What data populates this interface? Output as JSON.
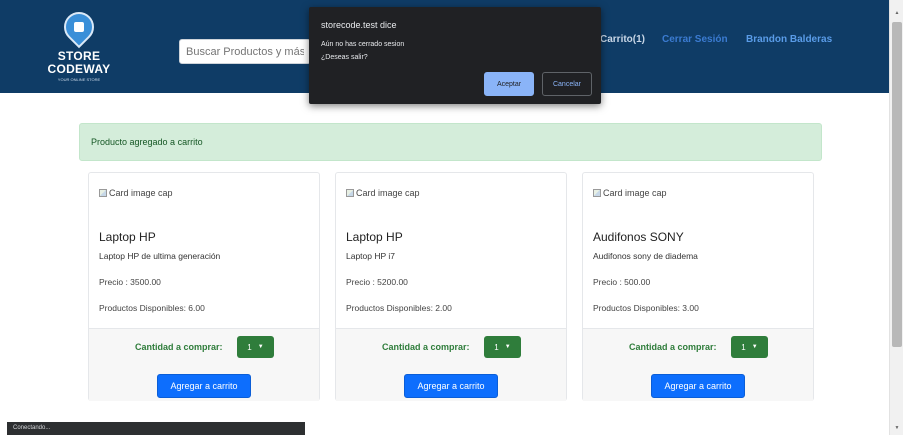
{
  "navbar": {
    "logo": {
      "line1": "STORE",
      "line2": "CODEWAY",
      "tagline": "YOUR ONLINE STORE"
    },
    "search": {
      "placeholder": "Buscar Productos y más!"
    },
    "links": {
      "cart": "Carrito(1)",
      "logout": "Cerrar Sesión",
      "user": "Brandon Balderas"
    },
    "colors": {
      "background": "#0f3c66",
      "cart": "#c8d6e6",
      "logout": "#3b7bd1",
      "user": "#5a9ce8"
    }
  },
  "dialog": {
    "title": "storecode.test dice",
    "message_line1": "Aún no has cerrado sesion",
    "message_line2": "¿Deseas salir?",
    "ok_label": "Aceptar",
    "cancel_label": "Cancelar"
  },
  "alert": {
    "text": "Producto agregado a carrito",
    "color": "#d4edda"
  },
  "cards": [
    {
      "image_alt": "Card image cap",
      "title": "Laptop HP",
      "description": "Laptop HP de ultima generación",
      "price": "Precio : 3500.00",
      "stock": "Productos Disponibles: 6.00",
      "qty_label": "Cantidad a comprar:",
      "qty_value": "1",
      "button": "Agregar a carrito"
    },
    {
      "image_alt": "Card image cap",
      "title": "Laptop HP",
      "description": "Laptop HP i7",
      "price": "Precio : 5200.00",
      "stock": "Productos Disponibles: 2.00",
      "qty_label": "Cantidad a comprar:",
      "qty_value": "1",
      "button": "Agregar a carrito"
    },
    {
      "image_alt": "Card image cap",
      "title": "Audifonos SONY",
      "description": "Audifonos sony de diadema",
      "price": "Precio : 500.00",
      "stock": "Productos Disponibles: 3.00",
      "qty_label": "Cantidad a comprar:",
      "qty_value": "1",
      "button": "Agregar a carrito"
    }
  ],
  "status_bar": {
    "text": "Conectando..."
  },
  "colors": {
    "primary_button": "#0d6efd",
    "qty_select": "#2f7d3b"
  },
  "icons": {
    "logo": "store-pin-icon",
    "broken_image": "broken-image-icon",
    "chevron": "chevron-down-icon",
    "scroll_up": "scroll-up-arrow-icon",
    "scroll_down": "scroll-down-arrow-icon"
  }
}
